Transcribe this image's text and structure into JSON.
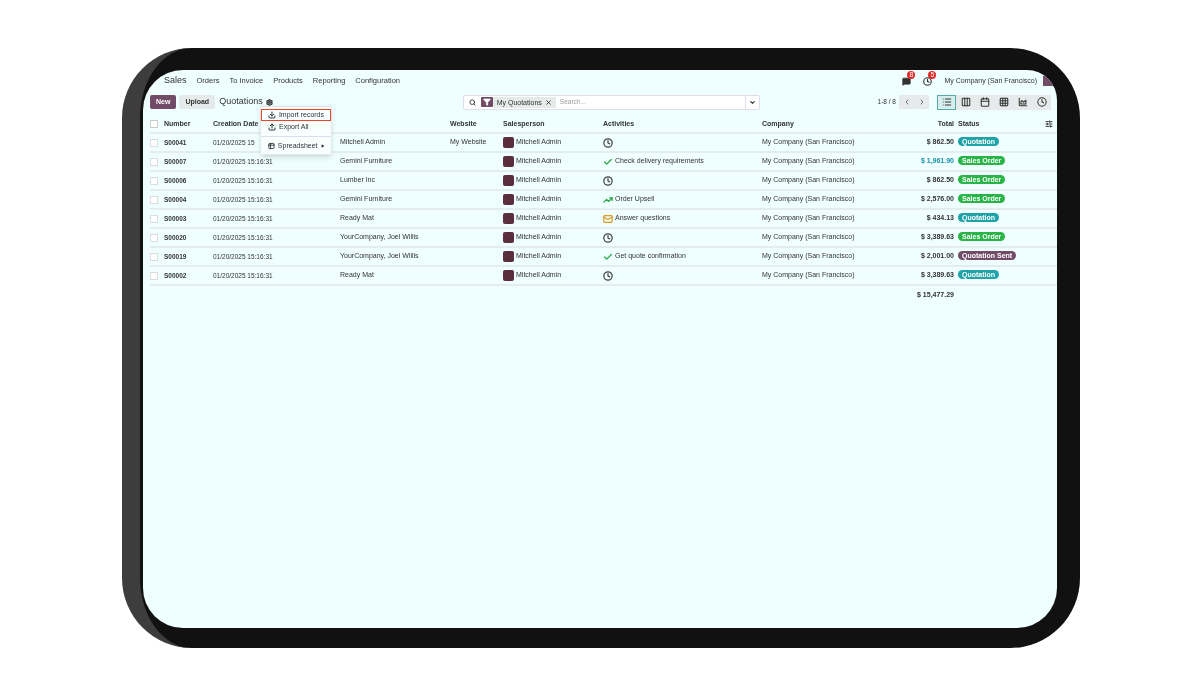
{
  "top_menu": {
    "app": "Sales",
    "items": [
      "Orders",
      "To Invoice",
      "Products",
      "Reporting",
      "Configuration"
    ],
    "badges": [
      {
        "kind": "chat",
        "count": "8"
      },
      {
        "kind": "activity",
        "count": "5"
      }
    ],
    "company": "My Company (San Francisco)"
  },
  "toolbar": {
    "buttons": [
      "New",
      "Upload"
    ],
    "title": "Quotations"
  },
  "gear_menu": {
    "items": [
      {
        "label": "Import records",
        "kind": "import",
        "selected": true
      },
      {
        "label": "Export All",
        "kind": "export",
        "selected": false
      },
      {
        "label": "Spreadsheet",
        "kind": "spreadsheet",
        "selected": false
      }
    ]
  },
  "search": {
    "facet": "My Quotations",
    "placeholder": "Search..."
  },
  "pager": "1-8 / 8",
  "views": [
    {
      "kind": "list",
      "selected": true
    },
    {
      "kind": "kanban",
      "selected": false
    },
    {
      "kind": "calendar",
      "selected": false
    },
    {
      "kind": "pivot",
      "selected": false
    },
    {
      "kind": "graph",
      "selected": false
    },
    {
      "kind": "activity",
      "selected": false
    }
  ],
  "table": {
    "select_all_checked": false,
    "columns": [
      "Number",
      "Creation Date",
      "",
      "Website",
      "Salesperson",
      "Activities",
      "Company",
      "Total",
      "Status"
    ],
    "rows": [
      {
        "checked": false,
        "number": "S00041",
        "date": "01/20/2025 15",
        "customer": "Mitchell Admin",
        "website": "My Website",
        "salesperson": "Mitchell Admin",
        "activity": {
          "kind": "clock"
        },
        "company": "My Company (San Francisco)",
        "total": "$ 862.50",
        "highlighted": false,
        "status": {
          "label": "Quotation",
          "color": "#1fa3a8"
        }
      },
      {
        "checked": false,
        "number": "S00007",
        "date": "01/20/2025 15:16:31",
        "customer": "Gemini Furniture",
        "salesperson": "Mitchell Admin",
        "activity": {
          "kind": "check",
          "text": "Check delivery requirements"
        },
        "company": "My Company (San Francisco)",
        "total": "$ 1,961.90",
        "highlighted": true,
        "status": {
          "label": "Sales Order",
          "color": "#28b446"
        }
      },
      {
        "checked": false,
        "number": "S00006",
        "date": "01/20/2025 15:16:31",
        "customer": "Lumber Inc",
        "salesperson": "Mitchell Admin",
        "activity": {
          "kind": "clock"
        },
        "company": "My Company (San Francisco)",
        "total": "$ 862.50",
        "highlighted": false,
        "status": {
          "label": "Sales Order",
          "color": "#28b446"
        }
      },
      {
        "checked": false,
        "number": "S00004",
        "date": "01/20/2025 15:16:31",
        "customer": "Gemini Furniture",
        "salesperson": "Mitchell Admin",
        "activity": {
          "kind": "chart",
          "text": "Order Upsell"
        },
        "company": "My Company (San Francisco)",
        "total": "$ 2,576.00",
        "highlighted": false,
        "status": {
          "label": "Sales Order",
          "color": "#28b446"
        }
      },
      {
        "checked": false,
        "number": "S00003",
        "date": "01/20/2025 15:16:31",
        "customer": "Ready Mat",
        "salesperson": "Mitchell Admin",
        "activity": {
          "kind": "mail",
          "text": "Answer questions"
        },
        "company": "My Company (San Francisco)",
        "total": "$ 434.13",
        "highlighted": false,
        "status": {
          "label": "Quotation",
          "color": "#1fa3a8"
        }
      },
      {
        "checked": false,
        "number": "S00020",
        "date": "01/20/2025 15:16:31",
        "customer": "YourCompany, Joel Willis",
        "salesperson": "Mitchell Admin",
        "activity": {
          "kind": "clock"
        },
        "company": "My Company (San Francisco)",
        "total": "$ 3,389.63",
        "highlighted": false,
        "status": {
          "label": "Sales Order",
          "color": "#28b446"
        }
      },
      {
        "checked": false,
        "number": "S00019",
        "date": "01/20/2025 15:16:31",
        "customer": "YourCompany, Joel Willis",
        "salesperson": "Mitchell Admin",
        "activity": {
          "kind": "check",
          "text": "Get quote confirmation"
        },
        "company": "My Company (San Francisco)",
        "total": "$ 2,001.00",
        "highlighted": false,
        "status": {
          "label": "Quotation Sent",
          "color": "#714b67"
        }
      },
      {
        "checked": false,
        "number": "S00002",
        "date": "01/20/2025 15:16:31",
        "customer": "Ready Mat",
        "salesperson": "Mitchell Admin",
        "activity": {
          "kind": "clock"
        },
        "company": "My Company (San Francisco)",
        "total": "$ 3,389.63",
        "highlighted": false,
        "status": {
          "label": "Quotation",
          "color": "#1fa3a8"
        }
      }
    ],
    "grand_total": "$ 15,477.29"
  }
}
